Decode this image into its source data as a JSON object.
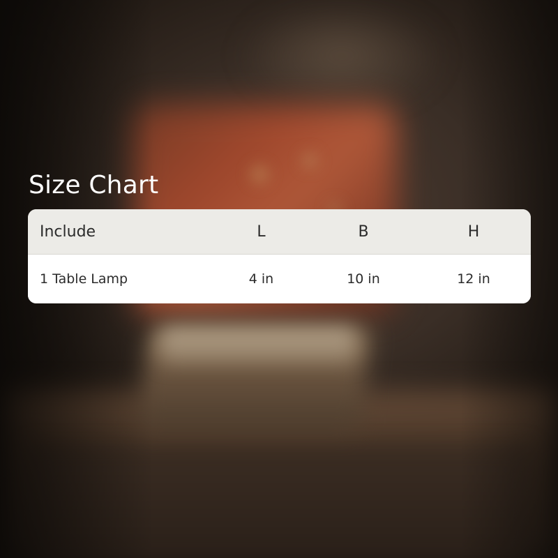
{
  "title": "Size Chart",
  "table": {
    "headers": [
      "Include",
      "L",
      "B",
      "H"
    ],
    "rows": [
      [
        "1 Table Lamp",
        "4 in",
        "10 in",
        "12 in"
      ]
    ]
  },
  "colors": {
    "title_text": "#ffffff",
    "header_background": "#ecebe7",
    "row_background": "#ffffff",
    "cell_text": "#2b2b2b"
  }
}
